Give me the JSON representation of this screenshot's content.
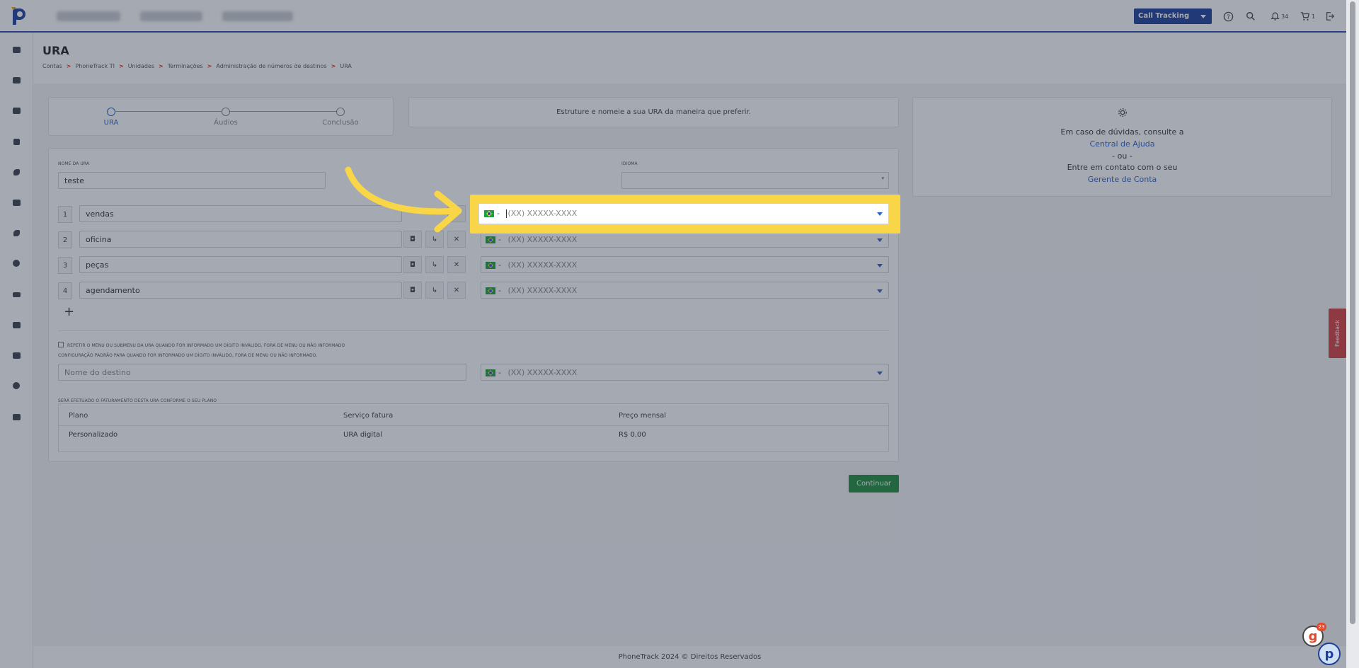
{
  "header": {
    "brand_logo": "phonetrack-logo",
    "product_select": "Call Tracking",
    "notifications_count": "34",
    "cart_count": "1"
  },
  "sidebar": {
    "icons": [
      "dashboard-icon",
      "building-icon",
      "briefcase-icon",
      "flag-icon",
      "phone-icon",
      "contact-card-icon",
      "phone-call-icon",
      "history-icon",
      "users-icon",
      "library-icon",
      "puzzle-icon",
      "gear-icon",
      "store-icon"
    ]
  },
  "page": {
    "title": "URA",
    "breadcrumb": [
      "Contas",
      "PhoneTrack TI",
      "Unidades",
      "Terminações",
      "Administração de números de destinos",
      "URA"
    ]
  },
  "stepper": {
    "steps": [
      "URA",
      "Áudios",
      "Conclusão"
    ]
  },
  "intro": {
    "text": "Estruture e nomeie a sua URA da maneira que preferir."
  },
  "form": {
    "name_label": "NOME DA URA",
    "name_value": "teste",
    "language_label": "IDIOMA",
    "language_value": "",
    "phone_placeholder": "(XX) XXXXX-XXXX",
    "options": [
      {
        "digit": "1",
        "label": "vendas"
      },
      {
        "digit": "2",
        "label": "oficina"
      },
      {
        "digit": "3",
        "label": "peças"
      },
      {
        "digit": "4",
        "label": "agendamento"
      }
    ],
    "repeat_checkbox_label": "REPETIR O MENU OU SUBMENU DA URA QUANDO FOR INFORMADO UM DÍGITO INVÁLIDO, FORA DE MENU OU NÃO INFORMADO",
    "default_config_label": "CONFIGURAÇÃO PADRÃO PARA QUANDO FOR INFORMADO UM DÍGITO INVÁLIDO, FORA DE MENU OU NÃO INFORMADO.",
    "destination_placeholder": "Nome do destino",
    "billing_label": "SERÁ EFETUADO O FATURAMENTO DESTA URA CONFORME O SEU PLANO",
    "billing_table": {
      "headers": [
        "Plano",
        "Serviço fatura",
        "Preço mensal"
      ],
      "row": [
        "Personalizado",
        "URA digital",
        "R$ 0,00"
      ]
    },
    "continue_label": "Continuar"
  },
  "help": {
    "line1": "Em caso de dúvidas, consulte a",
    "link1": "Central de Ajuda",
    "or": "- ou -",
    "line2": "Entre em contato com o seu",
    "link2": "Gerente de Conta"
  },
  "footer": {
    "text": "PhoneTrack 2024 © Direitos Reservados"
  },
  "feedback_label": "Feedback",
  "chat_badge": "23",
  "colors": {
    "highlight": "#f9d548",
    "primary": "#1e3e9c",
    "success": "#1f8e3e"
  }
}
